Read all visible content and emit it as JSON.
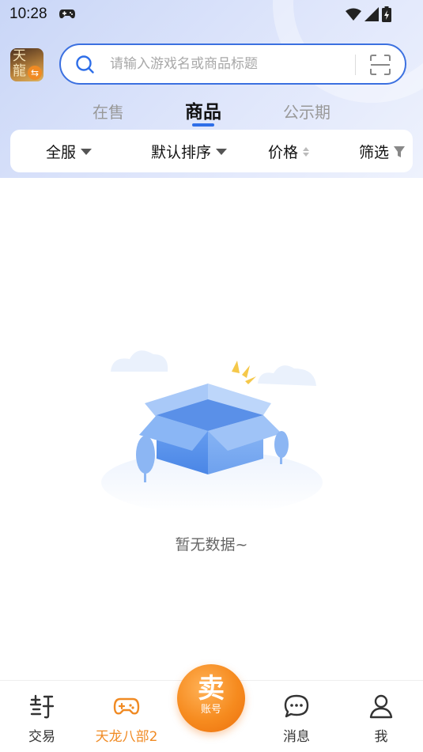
{
  "status_bar": {
    "time": "10:28"
  },
  "search": {
    "placeholder": "请输入游戏名或商品标题"
  },
  "game": {
    "avatar_text": "天龍"
  },
  "tabs": [
    {
      "label": "在售"
    },
    {
      "label": "商品",
      "active": true
    },
    {
      "label": "公示期"
    }
  ],
  "filters": {
    "server": "全服",
    "sort": "默认排序",
    "price": "价格",
    "filter": "筛选"
  },
  "empty_state": {
    "message": "暂无数据~"
  },
  "bottom_nav": {
    "items": [
      {
        "label": "交易",
        "icon": "trade-icon"
      },
      {
        "label": "天龙八部2",
        "icon": "gamepad-icon",
        "active": true
      },
      {
        "label": "消息",
        "icon": "message-icon"
      },
      {
        "label": "我",
        "icon": "user-icon"
      }
    ],
    "sell": {
      "big": "卖",
      "small": "账号"
    }
  },
  "colors": {
    "accent": "#2e6ee8",
    "orange": "#f08a23"
  }
}
